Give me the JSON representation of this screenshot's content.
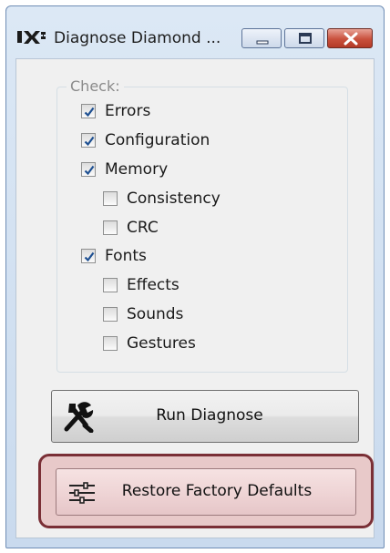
{
  "window": {
    "title": "Diagnose Diamond ..."
  },
  "caption_buttons": {
    "minimize": "minimize-icon",
    "maximize": "maximize-icon",
    "close": "close-icon"
  },
  "check_group": {
    "label": "Check:",
    "items": [
      {
        "label": "Errors",
        "checked": true
      },
      {
        "label": "Configuration",
        "checked": true
      },
      {
        "label": "Memory",
        "checked": true
      },
      {
        "label": "Consistency",
        "checked": false
      },
      {
        "label": "CRC",
        "checked": false
      },
      {
        "label": "Fonts",
        "checked": true
      },
      {
        "label": "Effects",
        "checked": false
      },
      {
        "label": "Sounds",
        "checked": false
      },
      {
        "label": "Gestures",
        "checked": false
      }
    ]
  },
  "buttons": {
    "run_diagnose": {
      "label": "Run Diagnose",
      "icon": "tools-icon"
    },
    "restore_defaults": {
      "label": "Restore Factory Defaults",
      "icon": "sliders-icon"
    }
  },
  "colors": {
    "highlight_border": "#7a2f36",
    "highlight_fill": "#e8c9c9",
    "check_mark": "#1d4f91"
  }
}
